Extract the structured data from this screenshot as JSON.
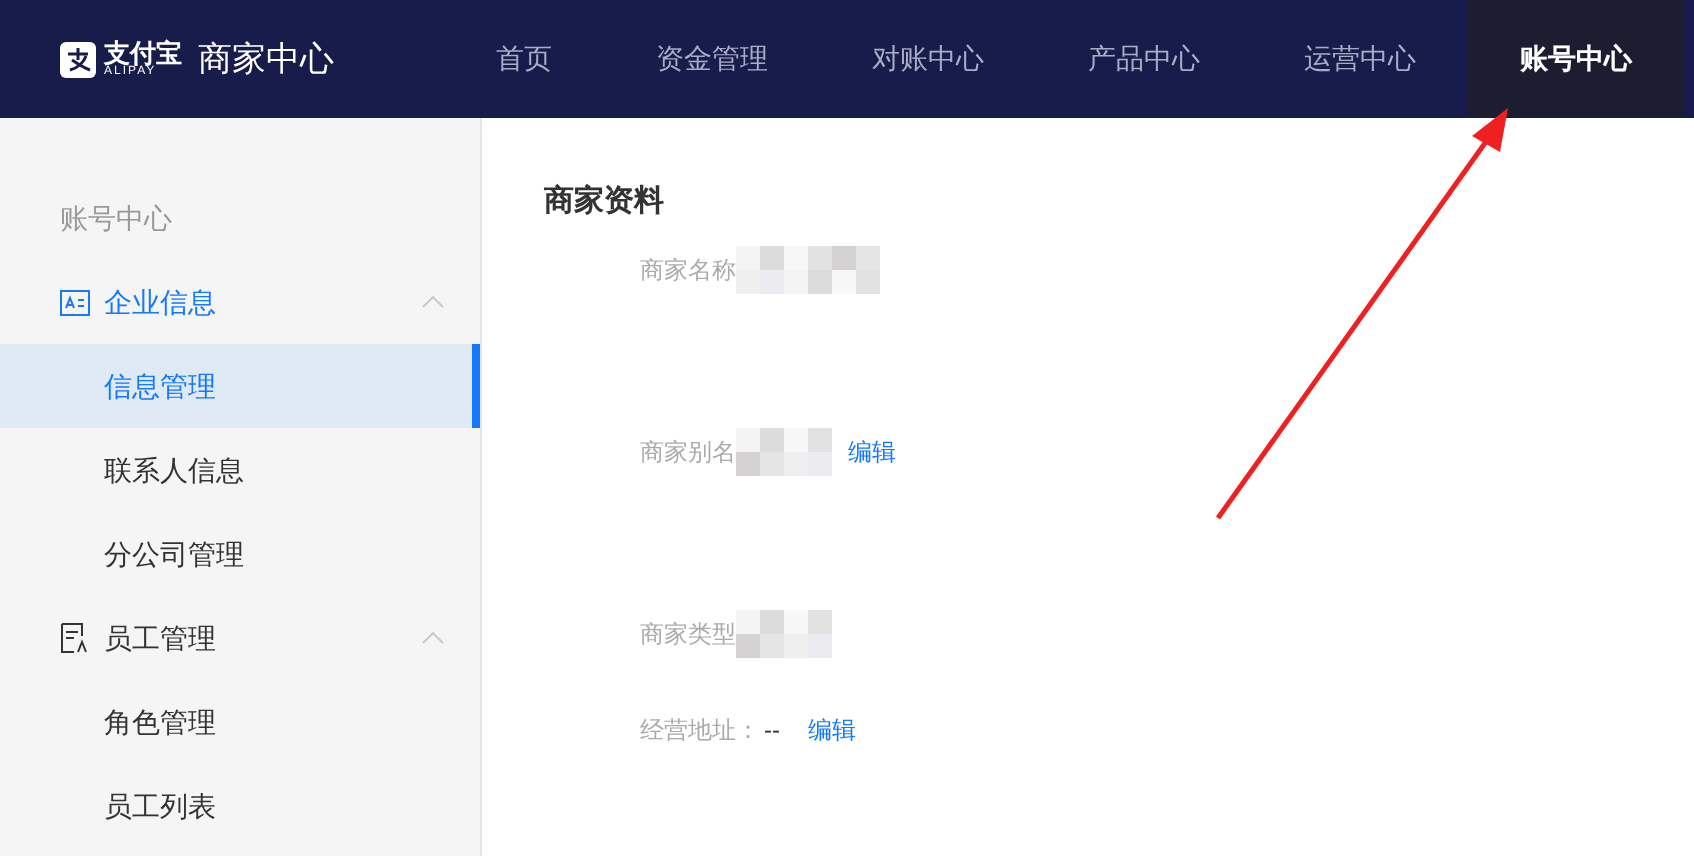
{
  "header": {
    "logo_text": "支付宝",
    "logo_sub": "ALIPAY",
    "product": "商家中心",
    "nav": [
      {
        "label": "首页",
        "selected": false
      },
      {
        "label": "资金管理",
        "selected": false
      },
      {
        "label": "对账中心",
        "selected": false
      },
      {
        "label": "产品中心",
        "selected": false
      },
      {
        "label": "运营中心",
        "selected": false
      },
      {
        "label": "账号中心",
        "selected": true
      }
    ]
  },
  "sidebar": {
    "title": "账号中心",
    "groups": [
      {
        "label": "企业信息",
        "expanded": true,
        "children": [
          {
            "label": "信息管理",
            "selected": true
          },
          {
            "label": "联系人信息",
            "selected": false
          },
          {
            "label": "分公司管理",
            "selected": false
          }
        ]
      },
      {
        "label": "员工管理",
        "expanded": true,
        "children": [
          {
            "label": "角色管理",
            "selected": false
          },
          {
            "label": "员工列表",
            "selected": false
          }
        ]
      }
    ]
  },
  "content": {
    "title": "商家资料",
    "fields": [
      {
        "label": "商家名称",
        "kind": "redacted"
      },
      {
        "label": "商家别名",
        "kind": "redacted",
        "edit": "编辑"
      },
      {
        "label": "商家类型",
        "kind": "redacted"
      },
      {
        "label": "经营地址：",
        "kind": "text",
        "value": "--",
        "edit": "编辑"
      }
    ]
  }
}
